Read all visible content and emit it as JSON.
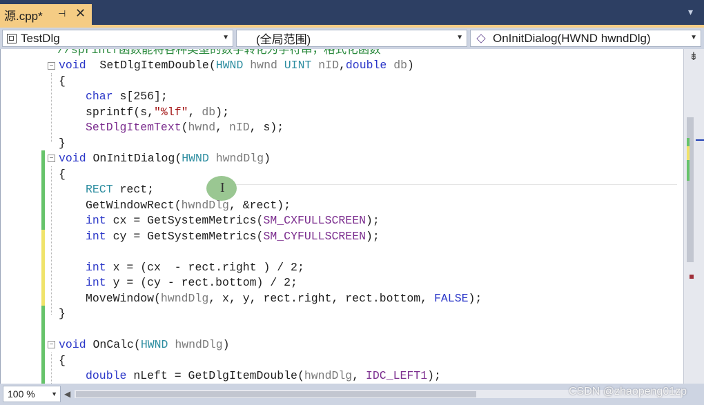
{
  "tab": {
    "title": "源.cpp*",
    "pin_icon": "pin-icon",
    "close_glyph": "✕",
    "overflow_glyph": "▾"
  },
  "nav": {
    "scope": "TestDlg",
    "range": "(全局范围)",
    "function": "OnInitDialog(HWND hwndDlg)"
  },
  "editor": {
    "lines": [
      [
        [
          "cm",
          "//sprintf函数能将各种类型的数字转化为字符串，格式化函数"
        ]
      ],
      [
        [
          "kw",
          "void"
        ],
        [
          "",
          "  SetDlgItemDouble("
        ],
        [
          "ty",
          "HWND"
        ],
        [
          "pa",
          " hwnd"
        ],
        [
          ",",
          " "
        ],
        [
          "ty",
          "UINT"
        ],
        [
          "pa",
          " nID"
        ],
        [
          "",
          ","
        ],
        [
          "kw",
          "double"
        ],
        [
          "pa",
          " db"
        ],
        [
          "",
          ")"
        ]
      ],
      [
        [
          "",
          "{"
        ]
      ],
      [
        [
          "kw",
          "char"
        ],
        [
          "",
          " s[256];"
        ]
      ],
      [
        [
          "",
          "sprintf(s,"
        ],
        [
          "st",
          "\"%lf\""
        ],
        [
          "",
          ", "
        ],
        [
          "pa",
          "db"
        ],
        [
          "",
          ");"
        ]
      ],
      [
        [
          "mc",
          "SetDlgItemText"
        ],
        [
          "",
          "("
        ],
        [
          "pa",
          "hwnd"
        ],
        [
          "",
          ", "
        ],
        [
          "pa",
          "nID"
        ],
        [
          "",
          ", s);"
        ]
      ],
      [
        [
          "",
          "}"
        ]
      ],
      [
        [
          "kw",
          "void"
        ],
        [
          "",
          " OnInitDialog("
        ],
        [
          "ty",
          "HWND"
        ],
        [
          "pa",
          " hwndDlg"
        ],
        [
          "",
          ")"
        ]
      ],
      [
        [
          "",
          "{"
        ]
      ],
      [
        [
          "ty",
          "RECT"
        ],
        [
          "",
          " rect;"
        ]
      ],
      [
        [
          "",
          "GetWindowRect("
        ],
        [
          "pa",
          "hwndDlg"
        ],
        [
          "",
          ", &rect);"
        ]
      ],
      [
        [
          "kw",
          "int"
        ],
        [
          "",
          " cx = GetSystemMetrics("
        ],
        [
          "mc",
          "SM_CXFULLSCREEN"
        ],
        [
          "",
          ");"
        ]
      ],
      [
        [
          "kw",
          "int"
        ],
        [
          "",
          " cy = GetSystemMetrics("
        ],
        [
          "mc",
          "SM_CYFULLSCREEN"
        ],
        [
          "",
          ");"
        ]
      ],
      [
        [
          "",
          ""
        ]
      ],
      [
        [
          "kw",
          "int"
        ],
        [
          "",
          " x = (cx  - rect.right ) / 2;"
        ]
      ],
      [
        [
          "kw",
          "int"
        ],
        [
          "",
          " y = (cy - rect.bottom) / 2;"
        ]
      ],
      [
        [
          "",
          "MoveWindow("
        ],
        [
          "pa",
          "hwndDlg"
        ],
        [
          "",
          ", x, y, rect.right, rect.bottom, "
        ],
        [
          "kw",
          "FALSE"
        ],
        [
          "",
          ");"
        ]
      ],
      [
        [
          "",
          "}"
        ]
      ],
      [
        [
          "",
          ""
        ]
      ],
      [
        [
          "kw",
          "void"
        ],
        [
          "",
          " OnCalc("
        ],
        [
          "ty",
          "HWND"
        ],
        [
          "pa",
          " hwndDlg"
        ],
        [
          "",
          ")"
        ]
      ],
      [
        [
          "",
          "{"
        ]
      ],
      [
        [
          "kw",
          "double"
        ],
        [
          "",
          " nLeft = GetDlgItemDouble("
        ],
        [
          "pa",
          "hwndDlg"
        ],
        [
          "",
          ", "
        ],
        [
          "mc",
          "IDC_LEFT1"
        ],
        [
          "",
          ");"
        ]
      ]
    ]
  },
  "statusbar": {
    "zoom": "100 %",
    "watermark": "CSDN @zhaopeng01zp"
  },
  "colors": {
    "tab_active": "#f5cc84",
    "tab_strip": "#2d3f63",
    "keyword": "#2a36c8",
    "type": "#2c8da0",
    "macro": "#7b2d8e",
    "string": "#a31515",
    "comment": "#2b8a3e"
  }
}
